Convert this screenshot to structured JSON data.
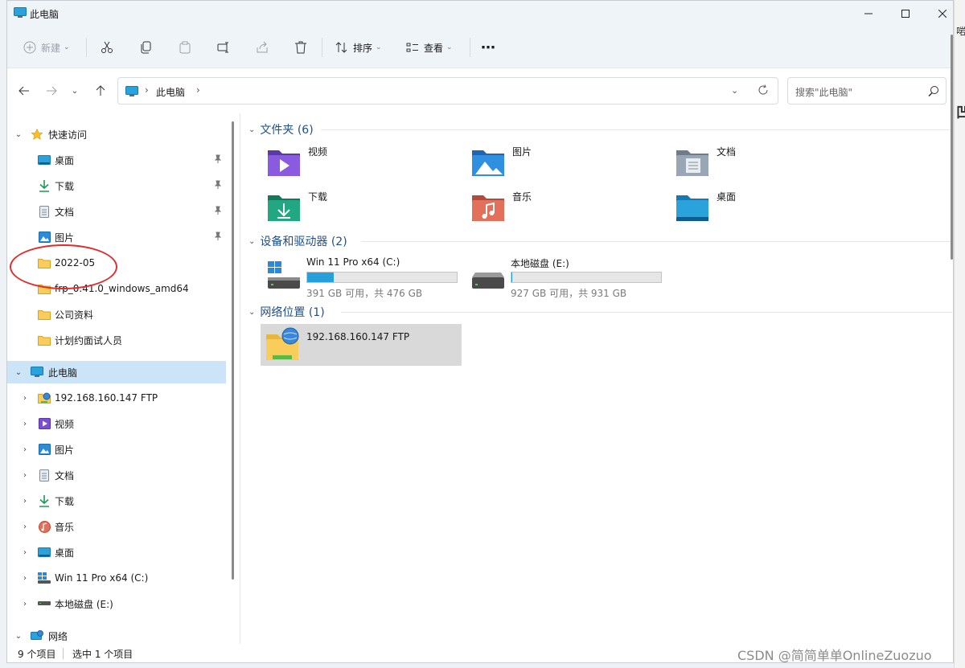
{
  "window": {
    "title": "此电脑"
  },
  "toolbar": {
    "new_label": "新建",
    "sort_label": "排序",
    "view_label": "查看",
    "more_label": "⋯"
  },
  "address": {
    "crumb": "此电脑",
    "search_placeholder": "搜索\"此电脑\""
  },
  "nav": {
    "quick_access": "快速访问",
    "quick_items": [
      {
        "label": "桌面",
        "pinned": true
      },
      {
        "label": "下载",
        "pinned": true
      },
      {
        "label": "文档",
        "pinned": true
      },
      {
        "label": "图片",
        "pinned": true
      },
      {
        "label": "2022-05",
        "pinned": false
      },
      {
        "label": "frp_0.41.0_windows_amd64",
        "pinned": false
      },
      {
        "label": "公司资料",
        "pinned": false
      },
      {
        "label": "计划约面试人员",
        "pinned": false
      }
    ],
    "this_pc": "此电脑",
    "pc_items": [
      {
        "label": "192.168.160.147  FTP",
        "icon": "ftp-icon"
      },
      {
        "label": "视频",
        "icon": "video-icon"
      },
      {
        "label": "图片",
        "icon": "pictures-icon"
      },
      {
        "label": "文档",
        "icon": "documents-icon"
      },
      {
        "label": "下载",
        "icon": "download-icon"
      },
      {
        "label": "音乐",
        "icon": "music-icon"
      },
      {
        "label": "桌面",
        "icon": "desktop-icon"
      },
      {
        "label": "Win 11 Pro x64 (C:)",
        "icon": "windows-drive-icon"
      },
      {
        "label": "本地磁盘 (E:)",
        "icon": "drive-icon"
      }
    ],
    "network": "网络"
  },
  "content": {
    "folders_header": "文件夹 (6)",
    "folders": [
      "视频",
      "图片",
      "文档",
      "下载",
      "音乐",
      "桌面"
    ],
    "devices_header": "设备和驱动器 (2)",
    "drives": [
      {
        "name": "Win 11 Pro x64 (C:)",
        "free": "391 GB 可用，共 476 GB",
        "used_fraction": 0.18,
        "color": "#26a0da"
      },
      {
        "name": "本地磁盘 (E:)",
        "free": "927 GB 可用，共 931 GB",
        "used_fraction": 0.004,
        "color": "#26a0da"
      }
    ],
    "network_header": "网络位置 (1)",
    "network_locations": [
      "192.168.160.147  FTP"
    ]
  },
  "status": {
    "count": "9 个项目",
    "selected": "选中 1 个项目"
  },
  "watermark": "CSDN @简简单单OnlineZuozuo",
  "colors": {
    "accent": "#26a0da",
    "selection": "#cce4f7",
    "annotation": "#e32b2b"
  }
}
